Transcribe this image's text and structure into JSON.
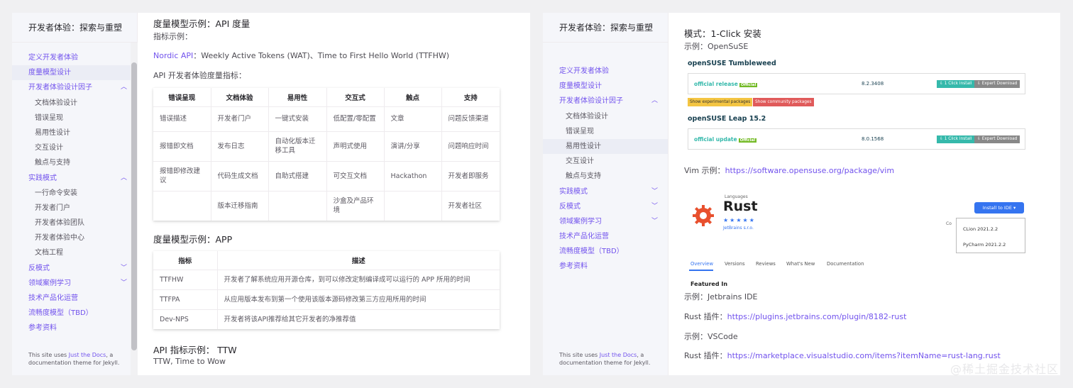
{
  "left": {
    "site_title": "开发者体验：探索与重塑",
    "nav": [
      {
        "label": "定义开发者体验",
        "level": 0
      },
      {
        "label": "度量模型设计",
        "level": 0,
        "active": true
      },
      {
        "label": "开发者体验设计因子",
        "level": 0,
        "chevron": "︿"
      },
      {
        "label": "文档体验设计",
        "level": 1
      },
      {
        "label": "错误呈现",
        "level": 1
      },
      {
        "label": "易用性设计",
        "level": 1
      },
      {
        "label": "交互设计",
        "level": 1
      },
      {
        "label": "触点与支持",
        "level": 1
      },
      {
        "label": "实践模式",
        "level": 0,
        "chevron": "︿"
      },
      {
        "label": "一行命令安装",
        "level": 1
      },
      {
        "label": "开发者门户",
        "level": 1
      },
      {
        "label": "开发者体验团队",
        "level": 1
      },
      {
        "label": "开发者体验中心",
        "level": 1
      },
      {
        "label": "文档工程",
        "level": 1
      },
      {
        "label": "反模式",
        "level": 0,
        "chevron": "﹀"
      },
      {
        "label": "领域案例学习",
        "level": 0,
        "chevron": "﹀"
      },
      {
        "label": "技术产品化运营",
        "level": 0
      },
      {
        "label": "流畅度模型（TBD）",
        "level": 0
      },
      {
        "label": "参考资料",
        "level": 0
      }
    ],
    "footer": {
      "prefix": "This site uses ",
      "link": "Just the Docs",
      "suffix": ", a documentation theme for Jekyll."
    },
    "main": {
      "h_api": "度量模型示例：API 度量",
      "example_label": "指标示例：",
      "nordic_link": "Nordic API",
      "nordic_text": "：Weekly Active Tokens (WAT)、Time to First Hello World (TTFHW)",
      "api_metrics_label": "API 开发者体验度量指标：",
      "table1": {
        "headers": [
          "错误呈现",
          "文档体验",
          "易用性",
          "交互式",
          "触点",
          "支持"
        ],
        "rows": [
          [
            "错误描述",
            "开发者门户",
            "一键式安装",
            "低配置/零配置",
            "文章",
            "问题反馈渠道"
          ],
          [
            "报错即文档",
            "发布日志",
            "自动化版本迁移工具",
            "声明式使用",
            "演讲/分享",
            "问题响应时间"
          ],
          [
            "报错即修改建议",
            "代码生成文档",
            "自助式搭建",
            "可交互文档",
            "Hackathon",
            "开发者即服务"
          ],
          [
            "",
            "版本迁移指南",
            "",
            "沙盒及产品环境",
            "",
            "开发者社区"
          ]
        ]
      },
      "h_app": "度量模型示例：APP",
      "table2": {
        "headers": [
          "指标",
          "描述"
        ],
        "rows": [
          [
            "TTFHW",
            "开发者了解系统应用开源仓库，到可以修改定制编译成可以运行的 APP 所用的时间"
          ],
          [
            "TTFPA",
            "从应用版本发布到第一个使用该版本源码修改第三方应用所用的时间"
          ],
          [
            "Dev-NPS",
            "开发者将该API推荐给其它开发者的净推荐值"
          ]
        ]
      },
      "h_ttw": "API 指标示例： TTW",
      "ttw_text": "TTW, Time to Wow"
    }
  },
  "right": {
    "site_title": "开发者体验：探索与重塑",
    "nav": [
      {
        "label": "定义开发者体验",
        "level": 0
      },
      {
        "label": "度量模型设计",
        "level": 0
      },
      {
        "label": "开发者体验设计因子",
        "level": 0,
        "chevron": "︿"
      },
      {
        "label": "文档体验设计",
        "level": 1
      },
      {
        "label": "错误呈现",
        "level": 1
      },
      {
        "label": "易用性设计",
        "level": 1,
        "active": true
      },
      {
        "label": "交互设计",
        "level": 1
      },
      {
        "label": "触点与支持",
        "level": 1
      },
      {
        "label": "实践模式",
        "level": 0,
        "chevron": "﹀"
      },
      {
        "label": "反模式",
        "level": 0,
        "chevron": "﹀"
      },
      {
        "label": "领域案例学习",
        "level": 0,
        "chevron": "﹀"
      },
      {
        "label": "技术产品化运营",
        "level": 0
      },
      {
        "label": "流畅度模型（TBD）",
        "level": 0
      },
      {
        "label": "参考资料",
        "level": 0
      }
    ],
    "footer": {
      "prefix": "This site uses ",
      "link": "Just the Docs",
      "suffix": ", a documentation theme for Jekyll."
    },
    "main": {
      "h_mode": "模式：1-Click 安装",
      "example_opensuse": "示例：OpenSuSE",
      "suse": {
        "tumbleweed_title": "openSUSE Tumbleweed",
        "official_release": "official release",
        "official_badge": "Official",
        "tumbleweed_version": "8.2.3408",
        "one_click": "1 Click Install",
        "expert": "Expert Download",
        "show_experimental": "Show experimental packages",
        "show_community": "Show community packages",
        "leap_title": "openSUSE Leap 15.2",
        "official_update": "official update",
        "leap_version": "8.0.1568"
      },
      "vim_label": "Vim 示例：",
      "vim_link": "https://software.opensuse.org/package/vim",
      "rust": {
        "languages": "Languages",
        "name": "Rust",
        "stars": "★★★★★",
        "vendor": "JetBrains s.r.o.",
        "install_btn": "Install to IDE ▾",
        "co": "Co",
        "menu": [
          "CLion 2021.2.2",
          "PyCharm 2021.2.2"
        ],
        "tabs": [
          "Overview",
          "Versions",
          "Reviews",
          "What's New",
          "Documentation"
        ],
        "featured": "Featured In"
      },
      "example_jetbrains": "示例：Jetbrains IDE",
      "rust_plugin_label": "Rust 插件：",
      "rust_plugin_link": "https://plugins.jetbrains.com/plugin/8182-rust",
      "example_vscode": "示例：VSCode",
      "rust_vsc_label": "Rust 插件：",
      "rust_vsc_link": "https://marketplace.visualstudio.com/items?itemName=rust-lang.rust"
    }
  },
  "watermark": "@稀土掘金技术社区",
  "colors": {
    "accent": "#7253ed",
    "sidebar_bg": "#f5f6fa",
    "active_bg": "#ebedf5"
  }
}
